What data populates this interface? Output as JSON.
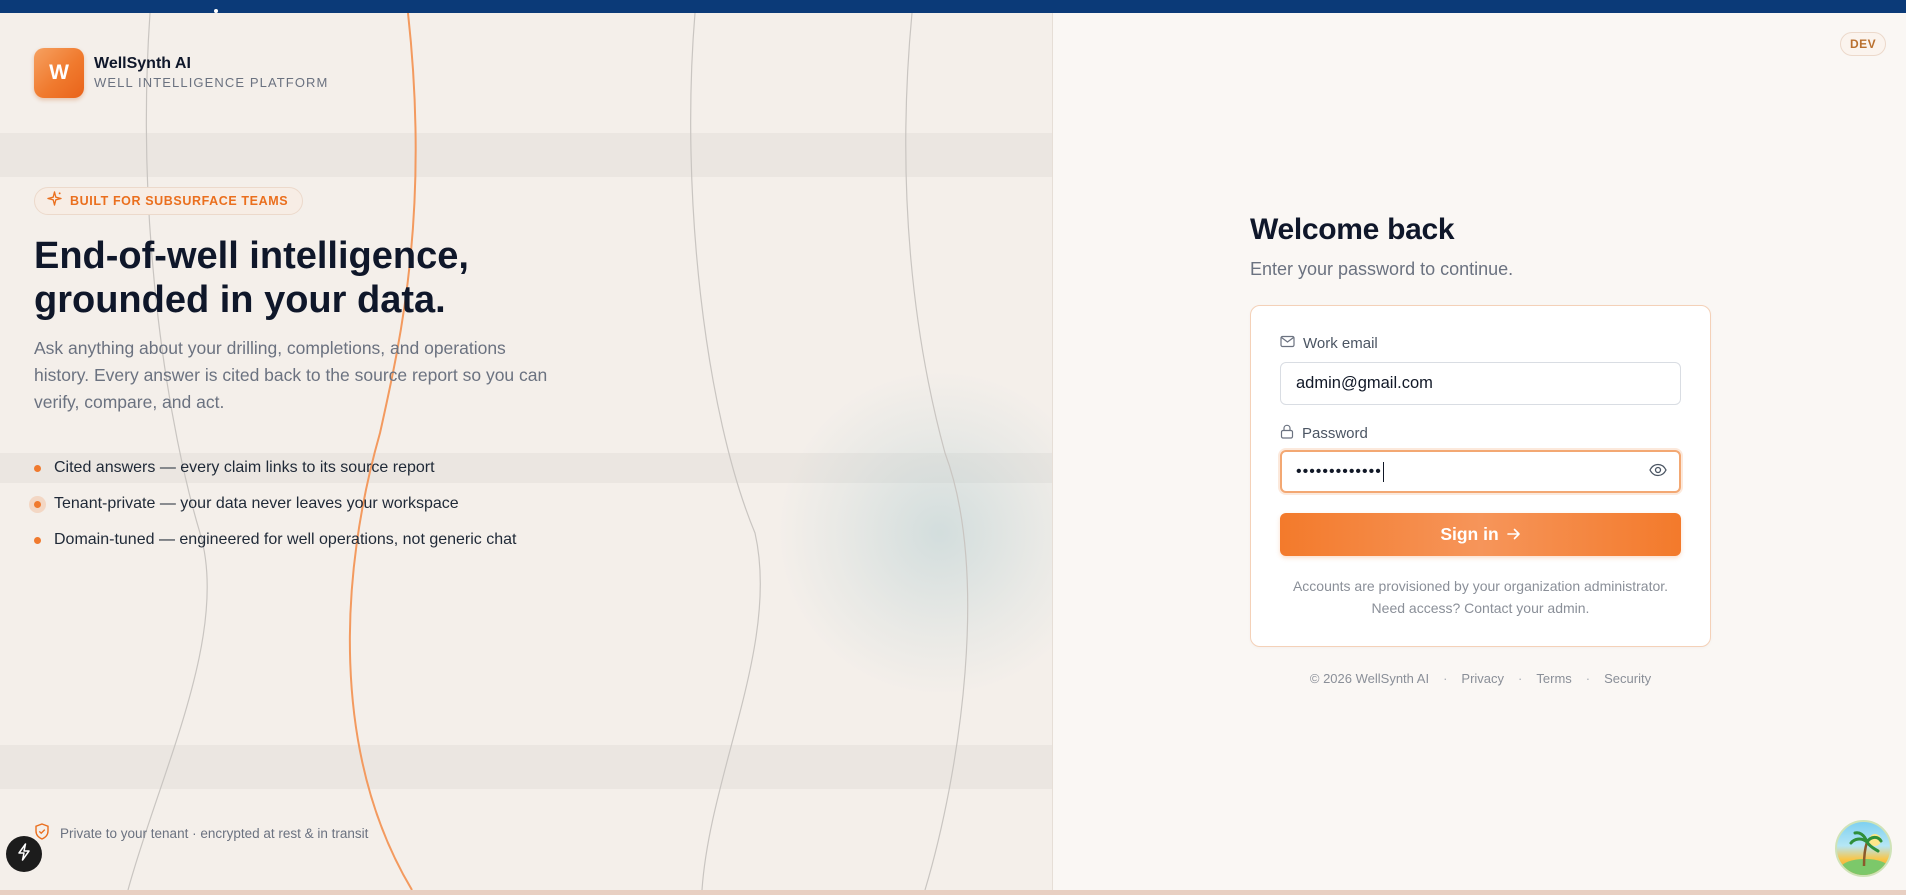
{
  "brand": {
    "logo_letter": "W",
    "name": "WellSynth AI",
    "subtitle": "WELL INTELLIGENCE PLATFORM"
  },
  "env_badge": "DEV",
  "left": {
    "pill": {
      "icon": "sparkle-icon",
      "text": "BUILT FOR SUBSURFACE TEAMS"
    },
    "headline": {
      "line1": "End-of-well intelligence,",
      "line2": "grounded in your data."
    },
    "lead": {
      "line1": "Ask anything about your drilling, completions, and operations",
      "line2": "history. Every answer is cited back to the source report so you can",
      "line3": "verify, compare, and act."
    },
    "bullets": [
      "Cited answers — every claim links to its source report",
      "Tenant-private — your data never leaves your workspace",
      "Domain-tuned — engineered for well operations, not generic chat"
    ],
    "security_note": {
      "icon": "shield-check-icon",
      "text": "Private to your tenant · encrypted at rest & in transit"
    }
  },
  "login": {
    "title": "Welcome back",
    "subtitle": "Enter your password to continue.",
    "email": {
      "icon": "mail-icon",
      "label": "Work email",
      "value": "admin@gmail.com"
    },
    "password": {
      "icon": "lock-icon",
      "label": "Password",
      "masked_value": "•••••••••••••",
      "toggle_icon": "eye-icon"
    },
    "submit": {
      "label": "Sign in",
      "icon": "arrow-right-icon"
    },
    "note": {
      "line1": "Accounts are provisioned by your organization administrator.",
      "line2": "Need access? Contact your admin."
    }
  },
  "footer": {
    "copyright": "© 2026 WellSynth AI",
    "links": [
      "Privacy",
      "Terms",
      "Security"
    ],
    "separator": "·"
  },
  "colors": {
    "accent": "#f07a2e",
    "topbar": "#0b3a78",
    "text": "#0f172a",
    "muted": "#6b7280",
    "card_border": "#f4d1b8"
  }
}
